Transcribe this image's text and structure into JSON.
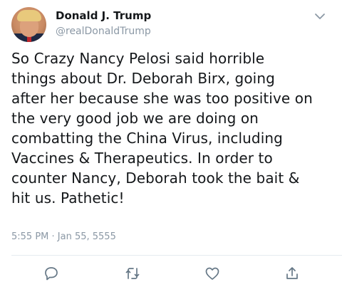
{
  "tweet": {
    "author_name": "Donald J. Trump",
    "author_handle": "@realDonaldTrump",
    "text": "So Crazy Nancy Pelosi said horrible\nthings about Dr. Deborah Birx, going\nafter her because she was too positive on\nthe very good job we are doing on\ncombatting the China Virus, including\nVaccines & Therapeutics. In order to\ncounter Nancy, Deborah took the bait &\nhit us. Pathetic!",
    "timestamp": "5:55 PM · Jan 55, 5555"
  },
  "icons": {
    "more": "chevron-down-icon",
    "reply": "reply-icon",
    "retweet": "retweet-icon",
    "like": "heart-icon",
    "share": "share-icon"
  },
  "colors": {
    "text": "#14171a",
    "muted": "#8b98a5",
    "divider": "#e6ecf0",
    "icon": "#657786"
  }
}
